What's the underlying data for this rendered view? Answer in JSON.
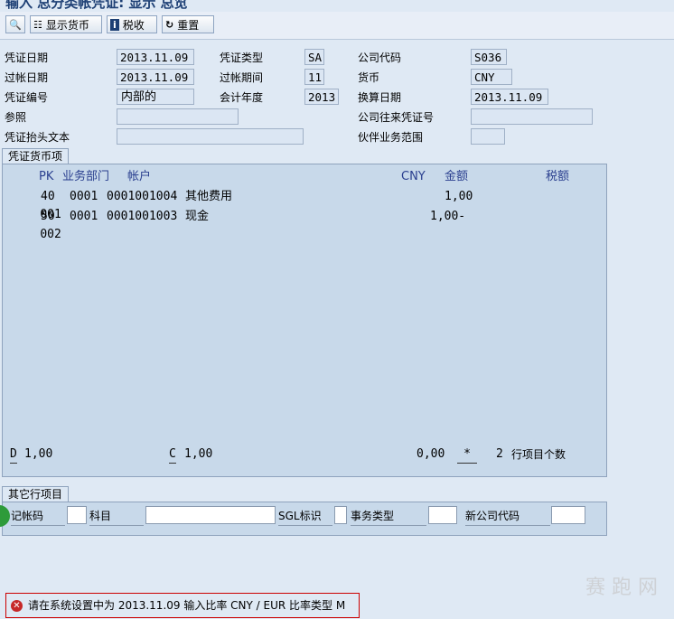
{
  "title": "输入 总分类帐凭证: 显示 总览",
  "toolbar": {
    "display_currency": "显示货币",
    "tax": "税收",
    "reset": "重置"
  },
  "header": {
    "doc_date_label": "凭证日期",
    "doc_date": "2013.11.09",
    "doc_type_label": "凭证类型",
    "doc_type": "SA",
    "company_code_label": "公司代码",
    "company_code": "S036",
    "posting_date_label": "过帐日期",
    "posting_date": "2013.11.09",
    "period_label": "过帐期间",
    "period": "11",
    "currency_label": "货币",
    "currency": "CNY",
    "doc_number_label": "凭证编号",
    "doc_number": "内部的",
    "fiscal_year_label": "会计年度",
    "fiscal_year": "2013",
    "translation_date_label": "换算日期",
    "translation_date": "2013.11.09",
    "reference_label": "参照",
    "reference": "",
    "intercompany_label": "公司往来凭证号",
    "intercompany": "",
    "header_text_label": "凭证抬头文本",
    "header_text": "",
    "partner_ba_label": "伙伴业务范围",
    "partner_ba": ""
  },
  "items_panel": {
    "tab": "凭证货币项",
    "col_pk": "PK",
    "col_ba": "业务部门",
    "col_account": "帐户",
    "col_currency": "CNY",
    "col_amount": "金额",
    "col_tax": "税额",
    "rows": [
      {
        "no": "001",
        "pk": "40",
        "ba": "0001",
        "account": "0001001004",
        "name": "其他费用",
        "amount": "1,00"
      },
      {
        "no": "002",
        "pk": "50",
        "ba": "0001",
        "account": "0001001003",
        "name": "现金",
        "amount": "1,00-"
      }
    ],
    "footer": {
      "debit_label": "D",
      "debit": "1,00",
      "credit_label": "C",
      "credit": "1,00",
      "balance": "0,00",
      "balance_flag": "*",
      "count": "2",
      "count_label": "行项目个数"
    }
  },
  "other_line": {
    "tab": "其它行项目",
    "posting_key_label": "记帐码",
    "account_label": "科目",
    "sgl_label": "SGL标识",
    "trans_type_label": "事务类型",
    "new_cc_label": "新公司代码"
  },
  "status_message": "请在系统设置中为 2013.11.09 输入比率 CNY / EUR 比率类型 M",
  "watermark": "赛 跑 网",
  "colors": {
    "accent": "#2a3f8f",
    "error": "#c62828"
  }
}
